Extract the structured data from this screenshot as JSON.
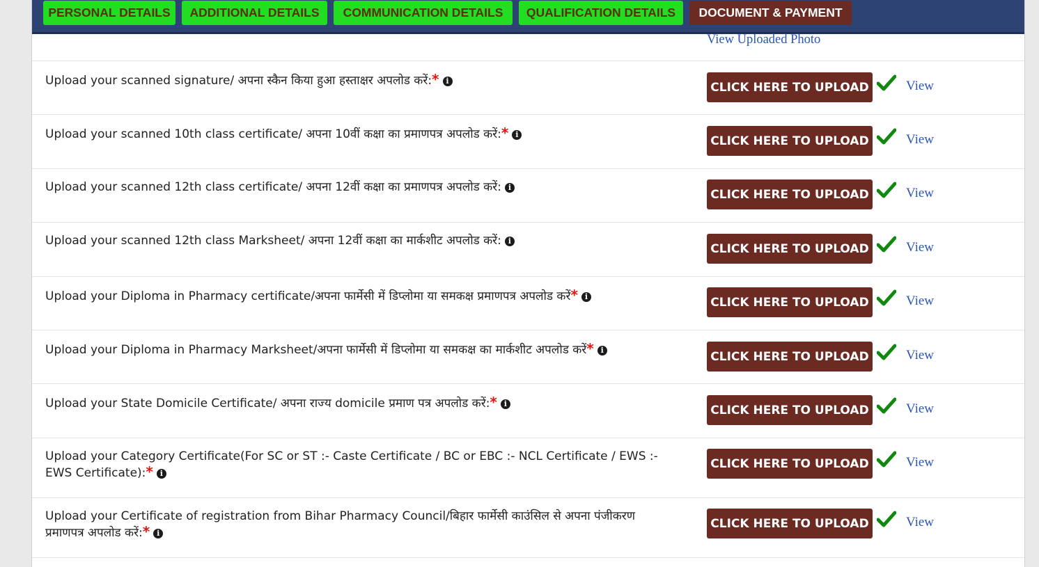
{
  "tabs": [
    {
      "label": "PERSONAL DETAILS"
    },
    {
      "label": "ADDITIONAL DETAILS"
    },
    {
      "label": "COMMUNICATION DETAILS"
    },
    {
      "label": "QUALIFICATION DETAILS"
    },
    {
      "label": "DOCUMENT & PAYMENT",
      "active": true
    }
  ],
  "photo_link": "View Uploaded Photo",
  "upload_label": "CLICK HERE TO UPLOAD",
  "view_label": "View",
  "required_mark": "*",
  "rows": [
    {
      "text": "Upload your scanned signature/ अपना स्कैन किया हुआ हस्ताक्षर अपलोड करें:",
      "required": true
    },
    {
      "text": "Upload your scanned 10th class certificate/ अपना 10वीं कक्षा का प्रमाणपत्र अपलोड करें:",
      "required": true
    },
    {
      "text": "Upload your scanned 12th class certificate/ अपना 12वीं कक्षा का प्रमाणपत्र अपलोड करें:",
      "required": false
    },
    {
      "text": "Upload your scanned 12th class Marksheet/ अपना 12वीं कक्षा का मार्कशीट अपलोड करें:",
      "required": false
    },
    {
      "text": "Upload your Diploma in Pharmacy certificate/अपना फार्मेसी में डिप्लोमा या समकक्ष प्रमाणपत्र अपलोड करें",
      "required": true
    },
    {
      "text": "Upload your Diploma in Pharmacy Marksheet/अपना फार्मेसी में डिप्लोमा या समकक्ष का मार्कशीट अपलोड करें",
      "required": true
    },
    {
      "text": "Upload your State Domicile Certificate/ अपना राज्य domicile प्रमाण पत्र अपलोड करें:",
      "required": true
    },
    {
      "text": "Upload your Category Certificate(For SC or ST :- Caste Certificate / BC or EBC :- NCL Certificate / EWS :- EWS Certificate):",
      "required": true
    },
    {
      "text": "Upload your Certificate of registration from Bihar Pharmacy Council/बिहार फार्मेसी काउंसिल से अपना पंजीकरण प्रमाणपत्र अपलोड करें:",
      "required": true
    }
  ],
  "colors": {
    "tab_green": "#22dd22",
    "tab_active": "#6b2a22",
    "header_bar": "#2d4373",
    "upload_button": "#6b2a22",
    "check_green": "#0f8a0f",
    "link_blue": "#2a56b8",
    "required_red": "#e8140f"
  },
  "icons": {
    "info": "info-circle-icon",
    "uploaded": "checkmark-icon"
  }
}
